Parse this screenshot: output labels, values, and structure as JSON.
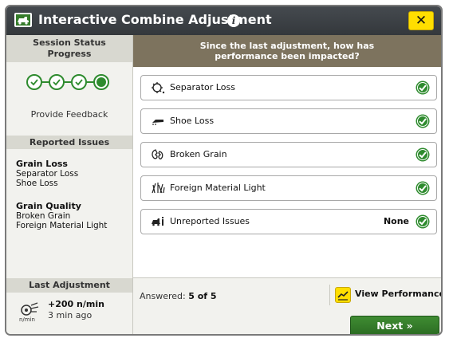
{
  "window": {
    "title": "Interactive Combine Adjustment",
    "close_label": "✕"
  },
  "session": {
    "heading": "Session Status",
    "progress_label": "Progress",
    "steps_completed": 3,
    "steps_total": 4,
    "feedback_label": "Provide Feedback"
  },
  "reported": {
    "heading": "Reported Issues",
    "groups": [
      {
        "title": "Grain Loss",
        "items": [
          "Separator Loss",
          "Shoe Loss"
        ]
      },
      {
        "title": "Grain Quality",
        "items": [
          "Broken Grain",
          "Foreign Material Light"
        ]
      }
    ]
  },
  "last_adjustment": {
    "heading": "Last Adjustment",
    "value": "+200 n/min",
    "time": "3 min ago",
    "icon": "rotor-speed-icon",
    "icon_text": "n/min"
  },
  "question": {
    "line1": "Since the last adjustment, how has",
    "line2": "performance been impacted?"
  },
  "options": [
    {
      "label": "Separator Loss",
      "icon": "separator-loss-icon",
      "value": ""
    },
    {
      "label": "Shoe Loss",
      "icon": "shoe-loss-icon",
      "value": ""
    },
    {
      "label": "Broken Grain",
      "icon": "broken-grain-icon",
      "value": ""
    },
    {
      "label": "Foreign Material Light",
      "icon": "foreign-material-icon",
      "value": ""
    },
    {
      "label": "Unreported Issues",
      "icon": "unreported-issues-icon",
      "value": "None"
    }
  ],
  "footer": {
    "answered_label": "Answered:",
    "answered_value": "5 of 5",
    "view_performance_label": "View Performance",
    "next_label": "Next »"
  },
  "colors": {
    "title_bar": "#3b3f43",
    "accent_yellow": "#ffde00",
    "question_bg": "#7d735e",
    "check_green": "#2e8b2e",
    "next_green": "#367c2b"
  }
}
